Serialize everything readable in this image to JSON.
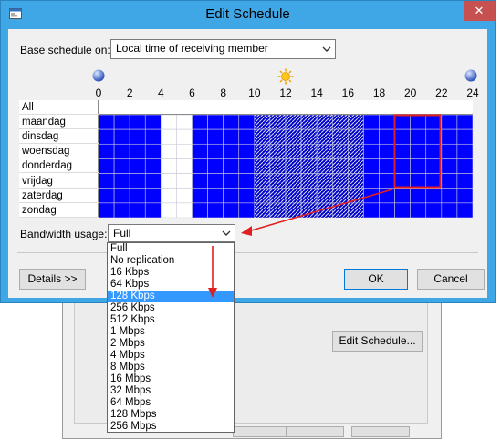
{
  "title": "Edit Schedule",
  "close_glyph": "✕",
  "base_label": "Base schedule on:",
  "base_value": "Local time of receiving member",
  "hours": [
    "0",
    "2",
    "4",
    "6",
    "8",
    "10",
    "12",
    "14",
    "16",
    "18",
    "20",
    "22",
    "24"
  ],
  "icons": [
    "moon-icon",
    "sun-icon",
    "moon-icon"
  ],
  "all_label": "All",
  "days": [
    "maandag",
    "dinsdag",
    "woensdag",
    "donderdag",
    "vrijdag",
    "zaterdag",
    "zondag"
  ],
  "schedule_legend": {
    "full": "#0000ff",
    "none": "#ffffff",
    "partial": "hatched"
  },
  "schedule": [
    "FFFFNNFFFFHHHHHHHFFFFFFF",
    "FFFFNNFFFFHHHHHHHFFFFFFF",
    "FFFFNNFFFFHHHHHHHFFFFFFF",
    "FFFFNNFFFFHHHHHHHFFFFFFF",
    "FFFFNNFFFFHHHHHHHFFFFFFF",
    "FFFFNNFFFFHHHHHHHFFFFFFF",
    "FFFFNNFFFFHHHHHHHFFFFFFF"
  ],
  "bandwidth_label": "Bandwidth usage:",
  "bandwidth_value": "Full",
  "details_label": "Details >>",
  "ok_label": "OK",
  "cancel_label": "Cancel",
  "background_button_label": "Edit Schedule...",
  "options": [
    "Full",
    "No replication",
    "16 Kbps",
    "64 Kbps",
    "128 Kbps",
    "256 Kbps",
    "512 Kbps",
    "1 Mbps",
    "2 Mbps",
    "4 Mbps",
    "8 Mbps",
    "16 Mbps",
    "32 Mbps",
    "64 Mbps",
    "128 Mbps",
    "256 Mbps"
  ],
  "highlighted_option": "128 Kbps",
  "annotation_color": "#e02020"
}
